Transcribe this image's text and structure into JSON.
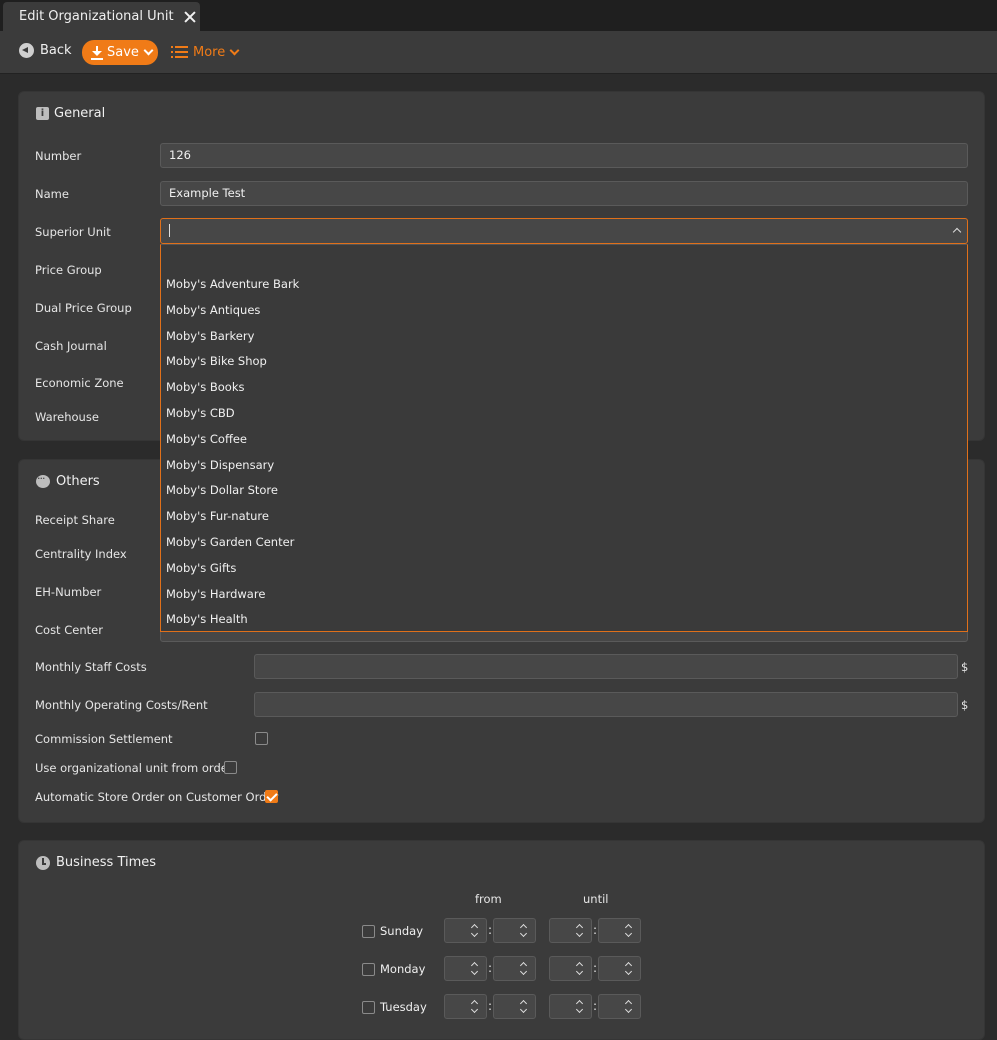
{
  "tab": {
    "title": "Edit Organizational Unit"
  },
  "toolbar": {
    "back_label": "Back",
    "save_label": "Save",
    "more_label": "More"
  },
  "general": {
    "title": "General",
    "fields": {
      "number_label": "Number",
      "number_value": "126",
      "name_label": "Name",
      "name_value": "Example Test",
      "superior_label": "Superior Unit",
      "superior_value": "",
      "price_group_label": "Price Group",
      "dual_price_group_label": "Dual Price Group",
      "cash_journal_label": "Cash Journal",
      "economic_zone_label": "Economic Zone",
      "warehouse_label": "Warehouse"
    }
  },
  "dropdown": {
    "options": [
      "Moby's Adventure Bark",
      "Moby's Antiques",
      "Moby's Barkery",
      "Moby's Bike Shop",
      "Moby's Books",
      "Moby's CBD",
      "Moby's Coffee",
      "Moby's Dispensary",
      "Moby's Dollar Store",
      "Moby's Fur-nature",
      "Moby's Garden Center",
      "Moby's Gifts",
      "Moby's Hardware",
      "Moby's Health"
    ]
  },
  "others": {
    "title": "Others",
    "receipt_share_label": "Receipt Share",
    "centrality_label": "Centrality Index",
    "eh_number_label": "EH-Number",
    "cost_center_label": "Cost Center",
    "staff_costs_label": "Monthly Staff Costs",
    "operating_costs_label": "Monthly Operating Costs/Rent",
    "currency": "$",
    "commission_label": "Commission Settlement",
    "commission_checked": false,
    "use_org_unit_label": "Use organizational unit from order",
    "use_org_unit_checked": false,
    "auto_store_order_label": "Automatic Store Order on Customer Order",
    "auto_store_order_checked": true
  },
  "business_times": {
    "title": "Business Times",
    "from_label": "from",
    "until_label": "until",
    "days": [
      "Sunday",
      "Monday",
      "Tuesday"
    ]
  },
  "colors": {
    "accent": "#f07b17",
    "panel": "#3b3b3b",
    "background": "#2b2b2b"
  }
}
